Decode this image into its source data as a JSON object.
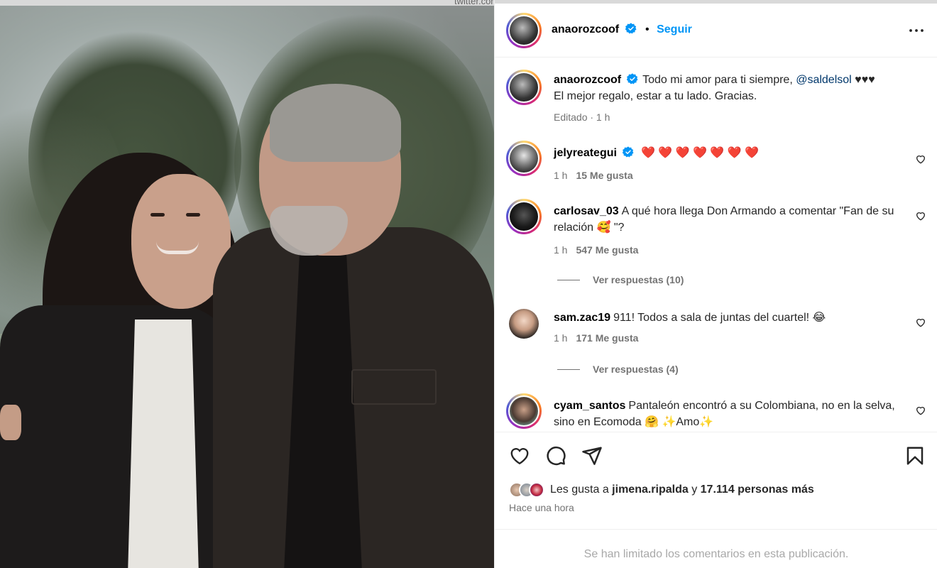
{
  "photo": {
    "top_text": "twitter.com/orozcoandok"
  },
  "post_header": {
    "username": "anaorozcoof",
    "follow_label": "Seguir",
    "separator": "•"
  },
  "caption": {
    "username": "anaorozcoof",
    "text_before": "Todo mi amor para ti siempre, ",
    "mention": "@saldelsol",
    "text_after": " ♥♥♥",
    "line2": "El mejor regalo, estar a tu lado. Gracias.",
    "meta": "Editado · 1 h"
  },
  "comments": [
    {
      "username": "jelyreategui",
      "verified": true,
      "text": "❤️ ❤️ ❤️ ❤️ ❤️ ❤️ ❤️",
      "time": "1 h",
      "likes": "15 Me gusta"
    },
    {
      "username": "carlosav_03",
      "verified": false,
      "text": "A qué hora llega Don Armando a comentar \"Fan de su relación 🥰 \"?",
      "time": "1 h",
      "likes": "547 Me gusta",
      "replies": "Ver respuestas (10)"
    },
    {
      "username": "sam.zac19",
      "verified": false,
      "text": "911! Todos a sala de juntas del cuartel! 😂",
      "time": "1 h",
      "likes": "171 Me gusta",
      "replies": "Ver respuestas (4)"
    },
    {
      "username": "cyam_santos",
      "verified": false,
      "text": "Pantaleón encontró a su Colombiana, no en la selva, sino en Ecomoda 🤗 ✨Amo✨"
    }
  ],
  "likes": {
    "prefix": "Les gusta a ",
    "user": "jimena.ripalda",
    "middle": " y ",
    "count": "17.114 personas más"
  },
  "time_ago": "Hace una hora",
  "limited_comments": "Se han limitado los comentarios en esta publicación.",
  "colors": {
    "accent": "#0095f6",
    "verified": "#0095f6",
    "heart_red": "#ed1c2e"
  },
  "icons": [
    "more-options-icon",
    "verified-icon",
    "heart-icon",
    "comment-icon",
    "share-icon",
    "bookmark-icon"
  ]
}
